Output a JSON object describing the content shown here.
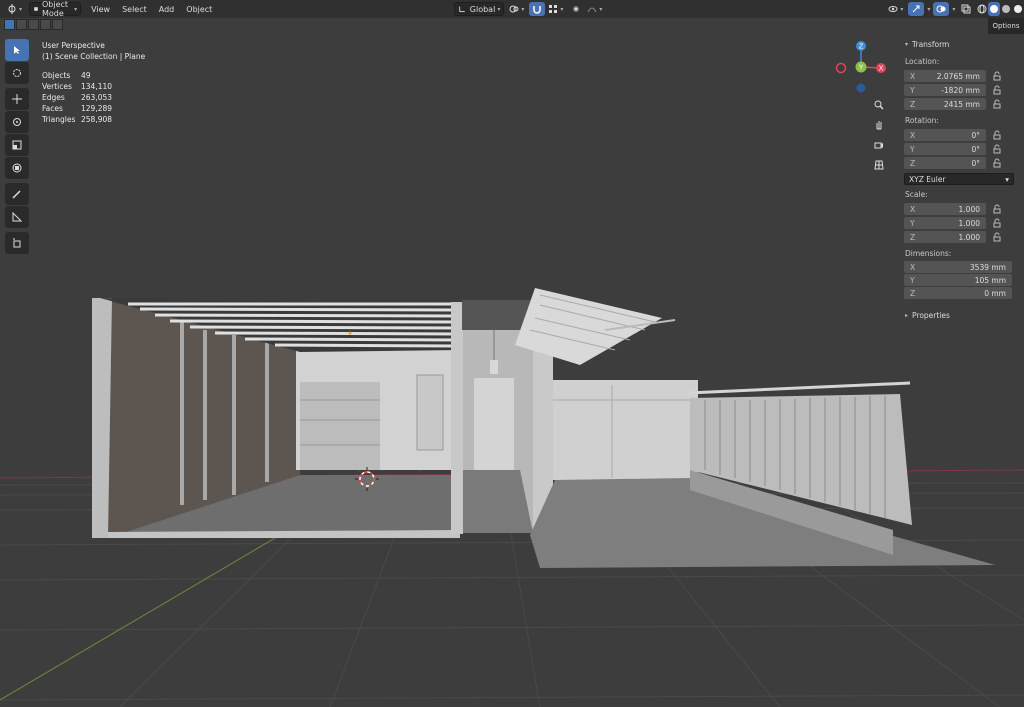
{
  "header": {
    "mode_label": "Object Mode",
    "menus": [
      "View",
      "Select",
      "Add",
      "Object"
    ],
    "orientation_label": "Global"
  },
  "subbar": {
    "options_label": "Options"
  },
  "overlay": {
    "view_name": "User Perspective",
    "collection": "(1) Scene Collection | Plane",
    "stats": [
      {
        "label": "Objects",
        "value": "49"
      },
      {
        "label": "Vertices",
        "value": "134,110"
      },
      {
        "label": "Edges",
        "value": "263,053"
      },
      {
        "label": "Faces",
        "value": "129,289"
      },
      {
        "label": "Triangles",
        "value": "258,908"
      }
    ]
  },
  "gizmo": {
    "z": "Z",
    "y": "Y",
    "x": "X"
  },
  "panel": {
    "title": "Transform",
    "location_label": "Location:",
    "location": [
      {
        "axis": "X",
        "value": "2.0765 mm"
      },
      {
        "axis": "Y",
        "value": "-1820 mm"
      },
      {
        "axis": "Z",
        "value": "2415 mm"
      }
    ],
    "rotation_label": "Rotation:",
    "rotation": [
      {
        "axis": "X",
        "value": "0°"
      },
      {
        "axis": "Y",
        "value": "0°"
      },
      {
        "axis": "Z",
        "value": "0°"
      }
    ],
    "rotation_mode": "XYZ Euler",
    "scale_label": "Scale:",
    "scale": [
      {
        "axis": "X",
        "value": "1.000"
      },
      {
        "axis": "Y",
        "value": "1.000"
      },
      {
        "axis": "Z",
        "value": "1.000"
      }
    ],
    "dimensions_label": "Dimensions:",
    "dimensions": [
      {
        "axis": "X",
        "value": "3539 mm"
      },
      {
        "axis": "Y",
        "value": "105 mm"
      },
      {
        "axis": "Z",
        "value": "0 mm"
      }
    ],
    "properties_label": "Properties"
  },
  "colors": {
    "accent": "#4772b3",
    "x_axis": "#e0445a",
    "y_axis": "#8bc34a",
    "z_axis": "#3b8ed8",
    "bg": "#3d3d3d"
  }
}
